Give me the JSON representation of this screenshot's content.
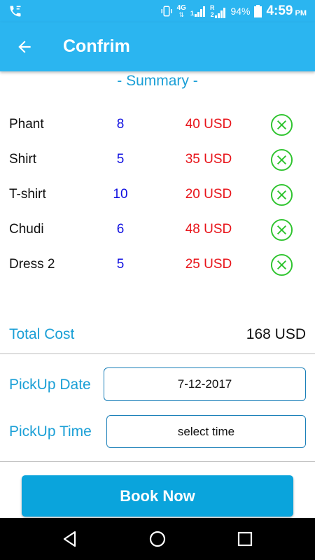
{
  "status_bar": {
    "network_top": "4G",
    "signal1_label": "1",
    "roaming": "R",
    "signal2_label": "2",
    "battery": "94%",
    "time": "4:59",
    "ampm": "PM",
    "left_icon": "call-icon"
  },
  "app_bar": {
    "title": "Confrim",
    "back_icon": "back-arrow-icon",
    "color": "#2bb5f0"
  },
  "summary": {
    "heading": "- Summary -",
    "items": [
      {
        "name": "Phant",
        "qty": "8",
        "price": "40 USD"
      },
      {
        "name": "Shirt",
        "qty": "5",
        "price": "35 USD"
      },
      {
        "name": "T-shirt",
        "qty": "10",
        "price": "20 USD"
      },
      {
        "name": "Chudi",
        "qty": "6",
        "price": "48 USD"
      },
      {
        "name": "Dress 2",
        "qty": "5",
        "price": "25 USD"
      }
    ],
    "remove_icon": "close-circle-icon",
    "remove_color": "#2ec42e"
  },
  "total": {
    "label": "Total Cost",
    "value": "168 USD"
  },
  "pickup": {
    "date_label": "PickUp Date",
    "date_value": "7-12-2017",
    "time_label": "PickUp Time",
    "time_value": "select time"
  },
  "actions": {
    "book_label": "Book Now"
  },
  "nav": {
    "back": "nav-back-icon",
    "home": "nav-home-icon",
    "recents": "nav-recents-icon"
  }
}
